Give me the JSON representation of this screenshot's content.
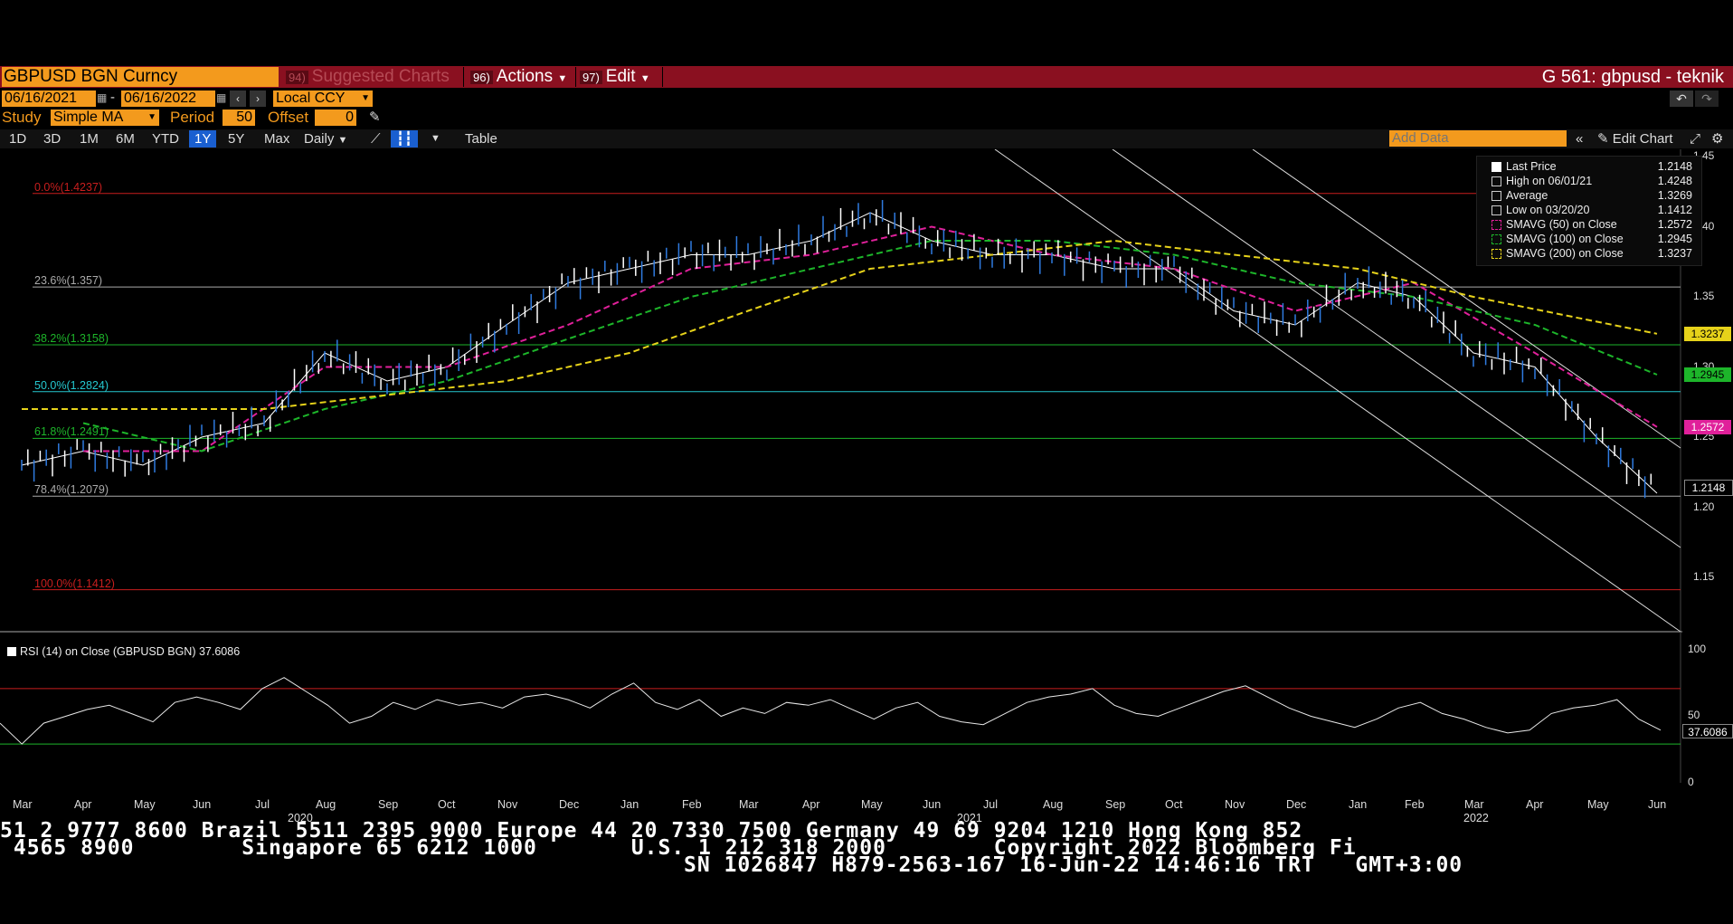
{
  "header": {
    "ticker": "GBPUSD BGN Curncy",
    "suggested_charts": "Suggested Charts",
    "suggested_num": "94)",
    "actions": "Actions",
    "actions_num": "96)",
    "edit": "Edit",
    "edit_num": "97)",
    "chart_title": "G 561: gbpusd - teknik"
  },
  "range": {
    "start": "06/16/2021",
    "end": "06/16/2022",
    "currency": "Local CCY",
    "dash": "-"
  },
  "study": {
    "label": "Study",
    "type": "Simple MA",
    "period_label": "Period",
    "period": "50",
    "offset_label": "Offset",
    "offset": "0"
  },
  "toolbar": {
    "periods": [
      "1D",
      "3D",
      "1M",
      "6M",
      "YTD",
      "1Y",
      "5Y",
      "Max"
    ],
    "active_period": "1Y",
    "frequency": "Daily",
    "table": "Table",
    "add_data_placeholder": "Add Data",
    "edit_chart": "Edit Chart"
  },
  "legend": [
    {
      "name": "Last Price",
      "value": "1.2148",
      "color": "#ffffff"
    },
    {
      "name": "High on 06/01/21",
      "value": "1.4248",
      "color": "#cccccc"
    },
    {
      "name": "Average",
      "value": "1.3269",
      "color": "#cccccc"
    },
    {
      "name": "Low on 03/20/20",
      "value": "1.1412",
      "color": "#cccccc"
    },
    {
      "name": "SMAVG (50)  on Close",
      "value": "1.2572",
      "color": "#e0209a"
    },
    {
      "name": "SMAVG (100)  on Close",
      "value": "1.2945",
      "color": "#1db52a"
    },
    {
      "name": "SMAVG (200)  on Close",
      "value": "1.3237",
      "color": "#e6d21a"
    }
  ],
  "price_tags": [
    {
      "value": "1.3237",
      "bg": "#e6d21a",
      "fg": "#000000"
    },
    {
      "value": "1.2945",
      "bg": "#1db52a",
      "fg": "#000000"
    },
    {
      "value": "1.2572",
      "bg": "#e0209a",
      "fg": "#ffffff"
    },
    {
      "value": "1.2148",
      "bg": "#000000",
      "fg": "#ffffff"
    }
  ],
  "rsi": {
    "label": "RSI (14)  on Close (GBPUSD BGN) 37.6086",
    "value_tag": "37.6086",
    "ticks": [
      "100",
      "50",
      "0"
    ]
  },
  "chart_data": {
    "type": "line",
    "series": [
      {
        "name": "Last Price",
        "color": "#ffffff",
        "x": [
          "Mar 2020",
          "Apr 2020",
          "May 2020",
          "Jun 2020",
          "Jul 2020",
          "Aug 2020",
          "Sep 2020",
          "Oct 2020",
          "Nov 2020",
          "Dec 2020",
          "Jan 2021",
          "Feb 2021",
          "Mar 2021",
          "Apr 2021",
          "May 2021",
          "Jun 2021",
          "Jul 2021",
          "Aug 2021",
          "Sep 2021",
          "Oct 2021",
          "Nov 2021",
          "Dec 2021",
          "Jan 2022",
          "Feb 2022",
          "Mar 2022",
          "Apr 2022",
          "May 2022",
          "Jun 2022"
        ],
        "values": [
          1.23,
          1.24,
          1.23,
          1.25,
          1.26,
          1.31,
          1.29,
          1.3,
          1.33,
          1.36,
          1.37,
          1.38,
          1.38,
          1.39,
          1.41,
          1.39,
          1.38,
          1.38,
          1.37,
          1.37,
          1.34,
          1.33,
          1.36,
          1.35,
          1.31,
          1.3,
          1.25,
          1.21
        ]
      },
      {
        "name": "SMAVG (50)  on Close",
        "color": "#e0209a",
        "x": [
          "Apr 2020",
          "Jun 2020",
          "Aug 2020",
          "Oct 2020",
          "Dec 2020",
          "Feb 2021",
          "Apr 2021",
          "Jun 2021",
          "Aug 2021",
          "Oct 2021",
          "Dec 2021",
          "Feb 2022",
          "Apr 2022",
          "Jun 2022"
        ],
        "values": [
          1.24,
          1.24,
          1.3,
          1.3,
          1.33,
          1.37,
          1.38,
          1.4,
          1.38,
          1.37,
          1.34,
          1.36,
          1.31,
          1.2572
        ]
      },
      {
        "name": "SMAVG (100)  on Close",
        "color": "#1db52a",
        "x": [
          "Apr 2020",
          "Jun 2020",
          "Aug 2020",
          "Oct 2020",
          "Dec 2020",
          "Feb 2021",
          "Apr 2021",
          "Jun 2021",
          "Aug 2021",
          "Oct 2021",
          "Dec 2021",
          "Feb 2022",
          "Apr 2022",
          "Jun 2022"
        ],
        "values": [
          1.26,
          1.24,
          1.27,
          1.29,
          1.32,
          1.35,
          1.37,
          1.39,
          1.39,
          1.38,
          1.36,
          1.35,
          1.33,
          1.2945
        ]
      },
      {
        "name": "SMAVG (200)  on Close",
        "color": "#e6d21a",
        "x": [
          "Mar 2020",
          "May 2020",
          "Jul 2020",
          "Sep 2020",
          "Nov 2020",
          "Jan 2021",
          "Mar 2021",
          "May 2021",
          "Jul 2021",
          "Sep 2021",
          "Nov 2021",
          "Jan 2022",
          "Mar 2022",
          "Jun 2022"
        ],
        "values": [
          1.27,
          1.27,
          1.27,
          1.28,
          1.29,
          1.31,
          1.34,
          1.37,
          1.38,
          1.39,
          1.38,
          1.37,
          1.35,
          1.3237
        ]
      }
    ],
    "fib_levels": [
      {
        "label": "0.0%(1.4237)",
        "value": 1.4237,
        "color": "#c81e1e"
      },
      {
        "label": "23.6%(1.357)",
        "value": 1.357,
        "color": "#aaaaaa"
      },
      {
        "label": "38.2%(1.3158)",
        "value": 1.3158,
        "color": "#1db52a"
      },
      {
        "label": "50.0%(1.2824)",
        "value": 1.2824,
        "color": "#25c8d0"
      },
      {
        "label": "61.8%(1.2491)",
        "value": 1.2491,
        "color": "#1db52a"
      },
      {
        "label": "78.4%(1.2079)",
        "value": 1.2079,
        "color": "#aaaaaa"
      },
      {
        "label": "100.0%(1.1412)",
        "value": 1.1412,
        "color": "#c81e1e"
      }
    ],
    "yticks": [
      "1.45",
      "1.40",
      "1.35",
      "1.30",
      "1.25",
      "1.20",
      "1.15"
    ],
    "ylim": [
      1.12,
      1.45
    ],
    "months": [
      "Mar",
      "Apr",
      "May",
      "Jun",
      "Jul",
      "Aug",
      "Sep",
      "Oct",
      "Nov",
      "Dec",
      "Jan",
      "Feb",
      "Mar",
      "Apr",
      "May",
      "Jun",
      "Jul",
      "Aug",
      "Sep",
      "Oct",
      "Nov",
      "Dec",
      "Jan",
      "Feb",
      "Mar",
      "Apr",
      "May",
      "Jun"
    ],
    "years": [
      "2020",
      "2021",
      "2022"
    ],
    "rsi_values": [
      45,
      30,
      45,
      50,
      55,
      58,
      52,
      46,
      60,
      64,
      60,
      55,
      70,
      78,
      68,
      58,
      45,
      50,
      60,
      55,
      62,
      58,
      60,
      56,
      64,
      66,
      62,
      56,
      66,
      74,
      60,
      55,
      62,
      50,
      56,
      52,
      60,
      58,
      62,
      55,
      48,
      56,
      60,
      50,
      46,
      44,
      52,
      60,
      64,
      66,
      70,
      58,
      52,
      50,
      56,
      62,
      68,
      72,
      64,
      56,
      50,
      46,
      42,
      48,
      56,
      60,
      52,
      48,
      42,
      38,
      40,
      52,
      56,
      58,
      62,
      48,
      40
    ]
  },
  "ticker_tape": {
    "line1": "51 2 9777 8600 Brazil 5511 2395 9000 Europe 44 20 7330 7500 Germany 49 69 9204 1210 Hong Kong 852",
    "line2": " 4565 8900        Singapore 65 6212 1000       U.S. 1 212 318 2000        Copyright 2022 Bloomberg Fi",
    "line3": "SN 1026847 H879-2563-167 16-Jun-22 14:46:16 TRT   GMT+3:00"
  }
}
